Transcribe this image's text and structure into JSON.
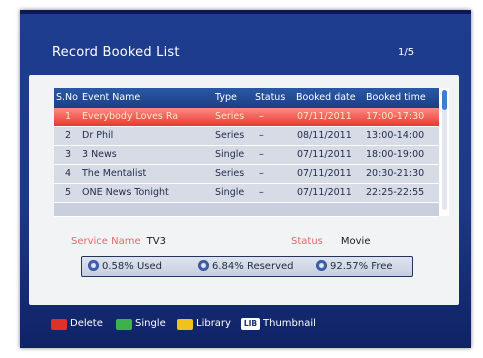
{
  "header": {
    "title": "Record Booked List",
    "page_indicator": "1/5"
  },
  "table": {
    "columns": [
      "S.No",
      "Event Name",
      "Type",
      "Status",
      "Booked date",
      "Booked time"
    ],
    "rows": [
      {
        "no": "1",
        "name": "Everybody Loves Ra",
        "type": "Series",
        "status": "–",
        "date": "07/11/2011",
        "time": "17:00-17:30",
        "selected": true
      },
      {
        "no": "2",
        "name": "Dr Phil",
        "type": "Series",
        "status": "–",
        "date": "08/11/2011",
        "time": "13:00-14:00",
        "selected": false
      },
      {
        "no": "3",
        "name": "3 News",
        "type": "Single",
        "status": "–",
        "date": "07/11/2011",
        "time": "18:00-19:00",
        "selected": false
      },
      {
        "no": "4",
        "name": "The Mentalist",
        "type": "Series",
        "status": "–",
        "date": "07/11/2011",
        "time": "20:30-21:30",
        "selected": false
      },
      {
        "no": "5",
        "name": "ONE News Tonight",
        "type": "Single",
        "status": "–",
        "date": "07/11/2011",
        "time": "22:25-22:55",
        "selected": false
      }
    ]
  },
  "info": {
    "service_label": "Service Name",
    "service_value": "TV3",
    "status_label": "Status",
    "status_value": "Movie"
  },
  "usage": {
    "used": "0.58% Used",
    "reserved": "6.84% Reserved",
    "free": "92.57% Free"
  },
  "footer": {
    "delete_label": "Delete",
    "single_label": "Single",
    "library_label": "Library",
    "lib_key": "LIB",
    "thumbnail_label": "Thumbnail"
  },
  "colors": {
    "red_key": "#e0302a",
    "green_key": "#3db24a",
    "yellow_key": "#f2c21c",
    "selected_row": "#e53a33",
    "header_bar": "#1c3f86"
  }
}
